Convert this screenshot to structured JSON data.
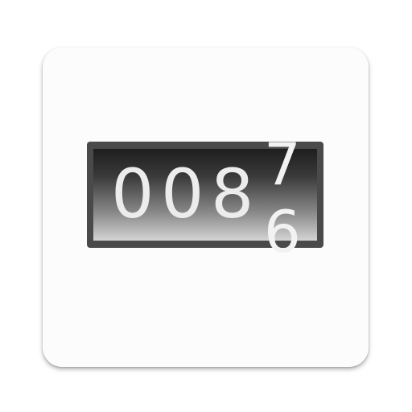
{
  "counter": {
    "digits": [
      "0",
      "0",
      "8"
    ],
    "rolling_digit_top": "7",
    "rolling_digit_bottom": "6"
  },
  "colors": {
    "tile_background": "#fcfcfc",
    "frame": "#4a4a4a",
    "digit": "#ececec"
  }
}
